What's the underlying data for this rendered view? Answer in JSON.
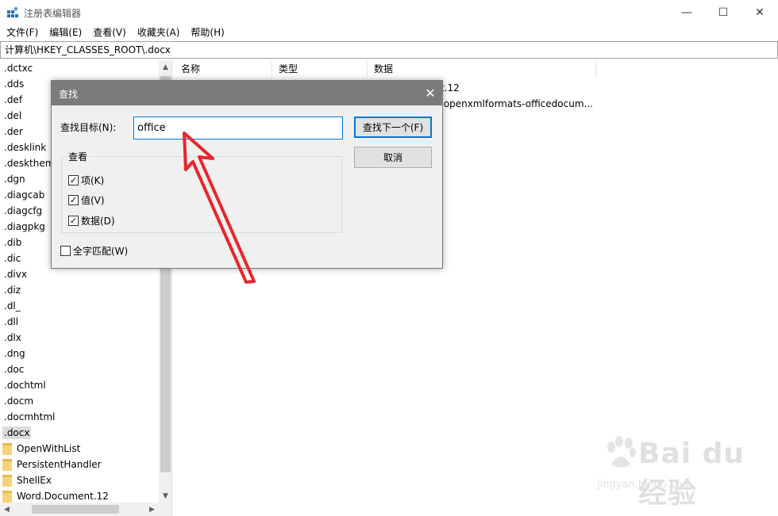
{
  "window": {
    "title": "注册表编辑器"
  },
  "window_controls": {
    "minimize": "—",
    "maximize": "☐",
    "close": "✕"
  },
  "menu": [
    "文件(F)",
    "编辑(E)",
    "查看(V)",
    "收藏夹(A)",
    "帮助(H)"
  ],
  "address": "计算机\\HKEY_CLASSES_ROOT\\.docx",
  "tree": {
    "items": [
      ".dctxc",
      ".dds",
      ".def",
      ".del",
      ".der",
      ".desklink",
      ".deskthem",
      ".dgn",
      ".diagcab",
      ".diagcfg",
      ".diagpkg",
      ".dib",
      ".dic",
      ".divx",
      ".diz",
      ".dl_",
      ".dll",
      ".dlx",
      ".dng",
      ".doc",
      ".dochtml",
      ".docm",
      ".docmhtml",
      ".docx"
    ],
    "selected": ".docx",
    "children": [
      "OpenWithList",
      "PersistentHandler",
      "ShellEx",
      "Word.Document.12"
    ]
  },
  "columns": {
    "name": "名称",
    "type": "类型",
    "data": "数据"
  },
  "values_rows": [
    {
      "data": "t.12"
    },
    {
      "data": ".openxmlformats-officedocum..."
    }
  ],
  "dialog": {
    "title": "查找",
    "find_label": "查找目标(N):",
    "find_value": "office",
    "find_next_button": "查找下一个(F)",
    "cancel_button": "取消",
    "look_at_group": "查看",
    "option_keys": "项(K)",
    "option_values": "值(V)",
    "option_data": "数据(D)",
    "match_whole": "全字匹配(W)",
    "keys_checked": true,
    "values_checked": true,
    "data_checked": true,
    "match_whole_checked": false
  },
  "watermark": {
    "text": "Bai du 经验",
    "sub": "jingyan.baidu.com"
  },
  "colors": {
    "dialog_title_bg": "#7b7b7b",
    "accent": "#0078d7",
    "arrow": "#e8262b"
  }
}
